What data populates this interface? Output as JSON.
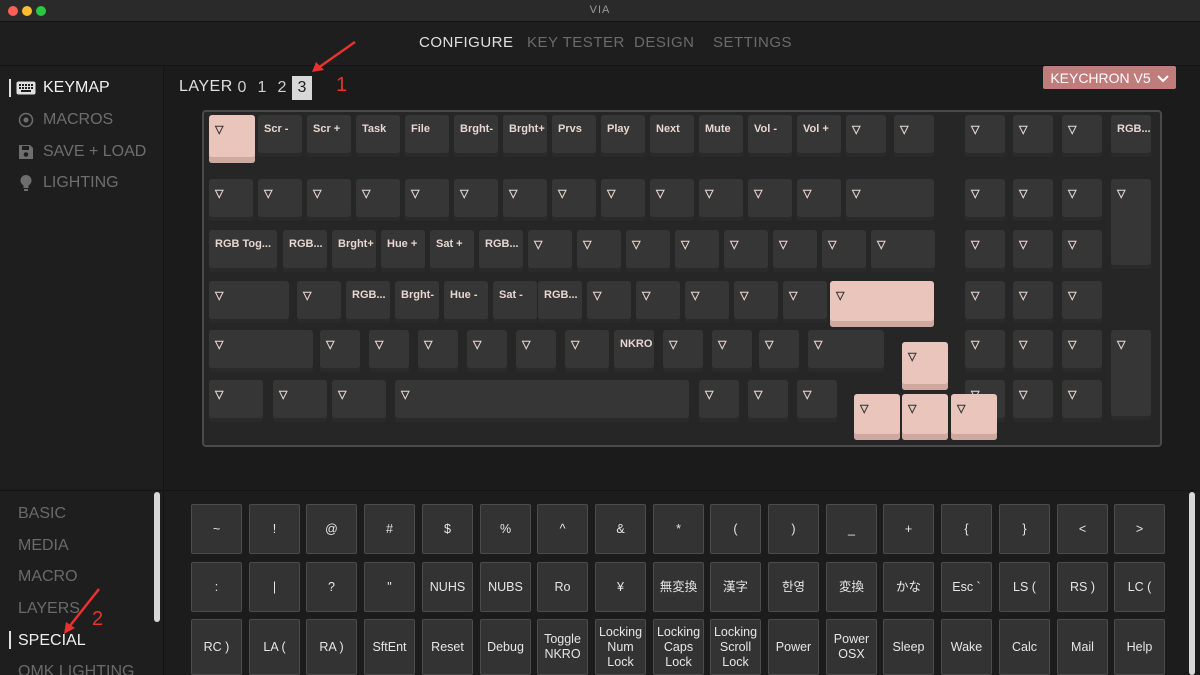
{
  "window": {
    "title": "VIA"
  },
  "topnav": {
    "configure": "CONFIGURE",
    "key_tester": "KEY TESTER",
    "design": "DESIGN",
    "settings": "SETTINGS"
  },
  "sidebar": {
    "keymap": "KEYMAP",
    "macros": "MACROS",
    "save_load": "SAVE + LOAD",
    "lighting": "LIGHTING"
  },
  "layers": {
    "label": "LAYER",
    "l0": "0",
    "l1": "1",
    "l2": "2",
    "l3": "3",
    "selected": 3
  },
  "device": {
    "name": "KEYCHRON V5"
  },
  "annotations": {
    "one": "1",
    "two": "2"
  },
  "categories": {
    "basic": "BASIC",
    "media": "MEDIA",
    "macro": "MACRO",
    "layers": "LAYERS",
    "special": "SPECIAL",
    "qmk_lighting": "QMK LIGHTING"
  },
  "keyboard_keys": [
    "▽",
    "Scr -",
    "Scr +",
    "Task",
    "File",
    "Brght-",
    "Brght+",
    "Prvs",
    "Play",
    "Next",
    "Mute",
    "Vol -",
    "Vol +",
    "▽",
    "▽",
    "▽",
    "▽",
    "▽",
    "RGB...",
    "▽",
    "▽",
    "▽",
    "▽",
    "▽",
    "▽",
    "▽",
    "▽",
    "▽",
    "▽",
    "▽",
    "▽",
    "▽",
    "▽",
    "▽",
    "▽",
    "▽",
    "▽",
    "RGB Tog...",
    "RGB...",
    "Brght+",
    "Hue +",
    "Sat +",
    "RGB...",
    "▽",
    "▽",
    "▽",
    "▽",
    "▽",
    "▽",
    "▽",
    "▽",
    "▽",
    "▽",
    "▽",
    "▽",
    "▽",
    "RGB...",
    "Brght-",
    "Hue -",
    "Sat -",
    "RGB...",
    "▽",
    "▽",
    "▽",
    "▽",
    "▽",
    "▽",
    "▽",
    "▽",
    "▽",
    "▽",
    "▽",
    "▽",
    "▽",
    "▽",
    "▽",
    "▽",
    "NKRO",
    "▽",
    "▽",
    "▽",
    "▽",
    "▽",
    "▽",
    "▽",
    "▽",
    "▽",
    "▽",
    "▽",
    "▽",
    "▽",
    "▽",
    "▽",
    "▽",
    "▽",
    "▽",
    "▽",
    "▽",
    "▽"
  ],
  "special_keys": [
    "~",
    "!",
    "@",
    "#",
    "$",
    "%",
    "^",
    "&",
    "*",
    "(",
    ")",
    "_",
    "+",
    "{",
    "}",
    "<",
    ">",
    ":",
    "|",
    "?",
    "\"",
    "NUHS",
    "NUBS",
    "Ro",
    "¥",
    "無変換",
    "漢字",
    "한영",
    "変換",
    "かな",
    "Esc `",
    "LS (",
    "RS )",
    "LC (",
    "RC )",
    "LA (",
    "RA )",
    "SftEnt",
    "Reset",
    "Debug",
    "Toggle\nNKRO",
    "Locking\nNum\nLock",
    "Locking\nCaps\nLock",
    "Locking\nScroll\nLock",
    "Power",
    "Power\nOSX",
    "Sleep",
    "Wake",
    "Calc",
    "Mail",
    "Help"
  ]
}
